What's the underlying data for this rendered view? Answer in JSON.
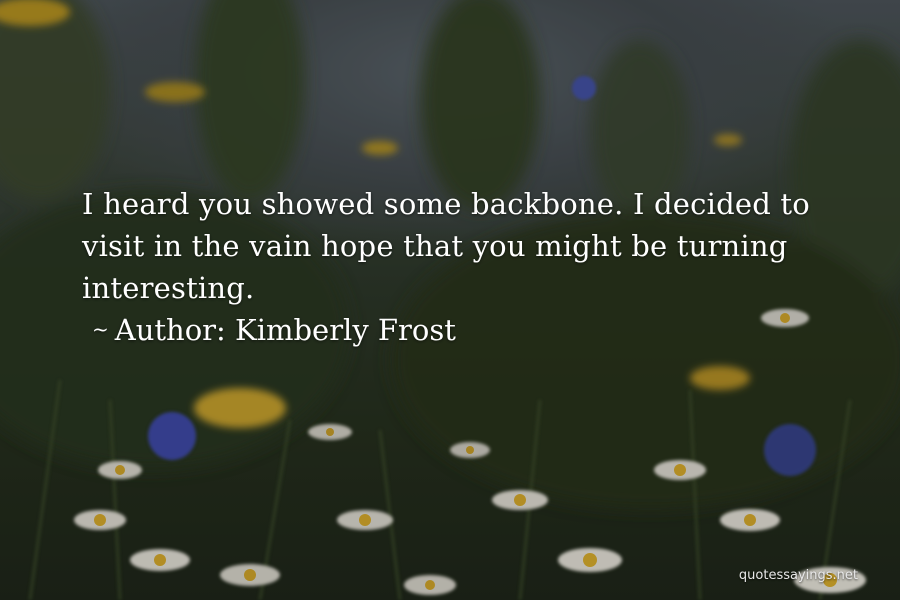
{
  "quote": {
    "text": "I heard you showed some backbone. I decided to visit in the vain hope that you might be turning interesting."
  },
  "attribution": {
    "prefix": "~",
    "author_label": "Author: Kimberly Frost"
  },
  "watermark": {
    "text": "quotessayings.net"
  },
  "colors": {
    "text": "#ffffff",
    "flower_white": "#e9e7dc",
    "flower_yellow": "#e0b631",
    "flower_blue": "#4c5bb8",
    "foliage": "#2f3e25"
  }
}
